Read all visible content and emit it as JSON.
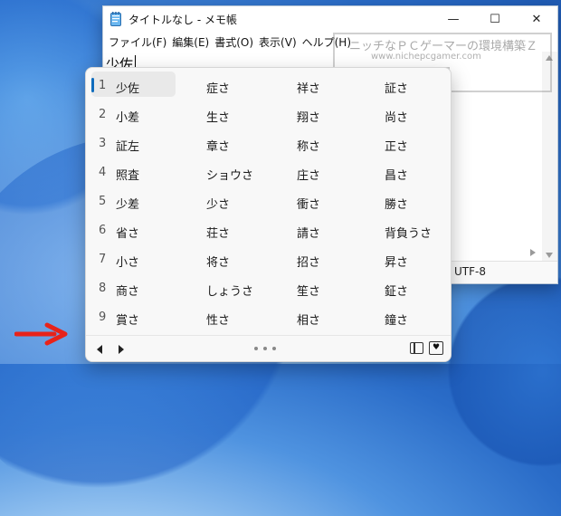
{
  "window": {
    "title": "タイトルなし - メモ帳",
    "controls": {
      "minimize": "—",
      "maximize": "☐",
      "close": "✕"
    }
  },
  "menu": [
    "ファイル(F)",
    "編集(E)",
    "書式(O)",
    "表示(V)",
    "ヘルプ(H)"
  ],
  "editor": {
    "text": "少佐"
  },
  "status": {
    "encoding": "UTF-8"
  },
  "watermark": {
    "line1": "ニッチなＰＣゲーマーの環境構築Ｚ",
    "line2": "www.nichepcgamer.com"
  },
  "ime": {
    "selected_index": 0,
    "rows": [
      {
        "num": "1",
        "c": [
          "少佐",
          "症さ",
          "祥さ",
          "証さ"
        ]
      },
      {
        "num": "2",
        "c": [
          "小差",
          "生さ",
          "翔さ",
          "尚さ"
        ]
      },
      {
        "num": "3",
        "c": [
          "証左",
          "章さ",
          "称さ",
          "正さ"
        ]
      },
      {
        "num": "4",
        "c": [
          "照査",
          "ショウさ",
          "庄さ",
          "昌さ"
        ]
      },
      {
        "num": "5",
        "c": [
          "少差",
          "少さ",
          "衝さ",
          "勝さ"
        ]
      },
      {
        "num": "6",
        "c": [
          "省さ",
          "荘さ",
          "請さ",
          "背負うさ"
        ]
      },
      {
        "num": "7",
        "c": [
          "小さ",
          "将さ",
          "招さ",
          "昇さ"
        ]
      },
      {
        "num": "8",
        "c": [
          "商さ",
          "しょうさ",
          "笙さ",
          "鉦さ"
        ]
      },
      {
        "num": "9",
        "c": [
          "賞さ",
          "性さ",
          "相さ",
          "鐘さ"
        ]
      }
    ]
  },
  "colors": {
    "accent": "#0f6cbd",
    "arrow": "#e8231a"
  },
  "icons": [
    "notepad-icon",
    "prev-page-icon",
    "next-page-icon",
    "page-dots-icon",
    "side-panel-icon",
    "favorite-icon",
    "red-arrow-icon"
  ]
}
